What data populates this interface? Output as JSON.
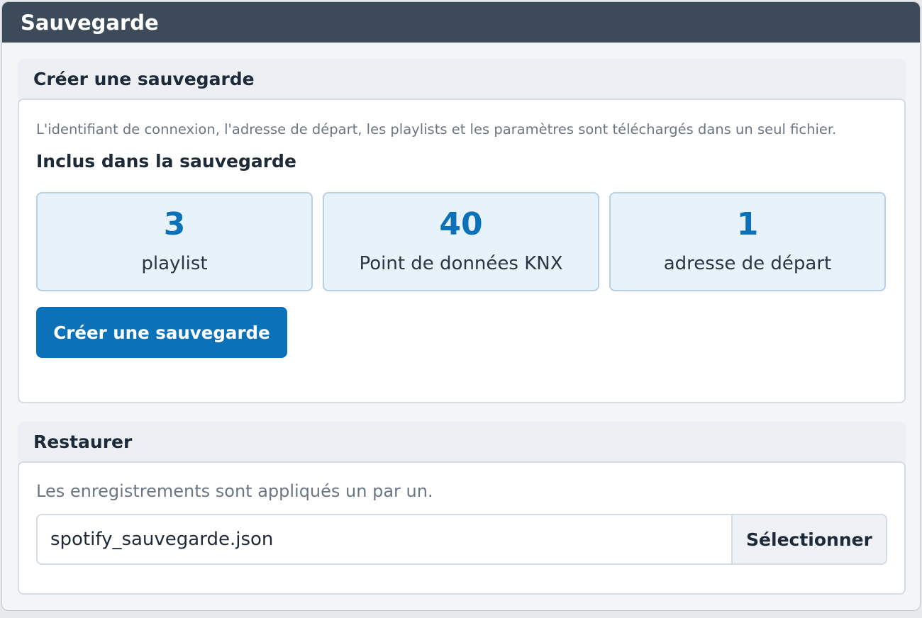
{
  "window": {
    "title": "Sauvegarde"
  },
  "create": {
    "header": "Créer une sauvegarde",
    "description": "L'identifiant de connexion, l'adresse de départ, les playlists et les paramètres sont téléchargés dans un seul fichier.",
    "subheading": "Inclus dans la sauvegarde",
    "stats": [
      {
        "value": "3",
        "label": "playlist"
      },
      {
        "value": "40",
        "label": "Point de données KNX"
      },
      {
        "value": "1",
        "label": "adresse de départ"
      }
    ],
    "button_label": "Créer une sauvegarde"
  },
  "restore": {
    "header": "Restaurer",
    "description": "Les enregistrements sont appliqués un par un.",
    "file_name": "spotify_sauvegarde.json",
    "select_label": "Sélectionner"
  },
  "colors": {
    "titlebar": "#3d4a5a",
    "accent": "#0b72b9",
    "card_bg": "#e8f2fb"
  }
}
